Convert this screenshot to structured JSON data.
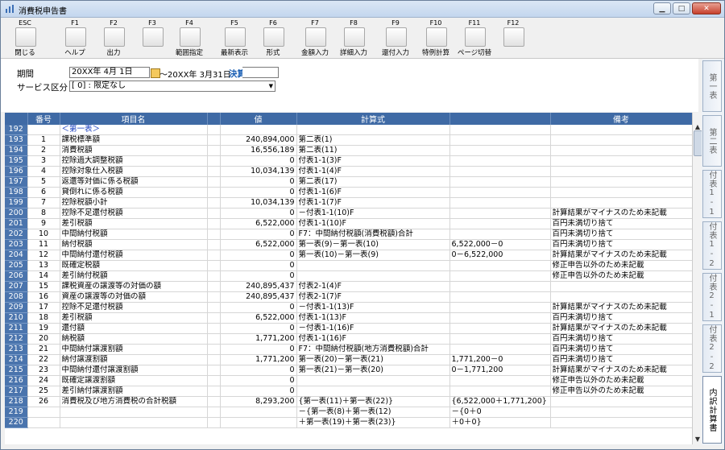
{
  "window": {
    "title": "消費税申告書",
    "btn_min": "▁",
    "btn_max": "□",
    "btn_close": "✕"
  },
  "toolbar": [
    {
      "key": "ESC",
      "label": "閉じる",
      "icon": "close-doc-icon"
    },
    {
      "key": "F1",
      "label": "ヘルプ",
      "icon": "help-icon"
    },
    {
      "key": "F2",
      "label": "出力",
      "icon": "print-icon"
    },
    {
      "key": "F3",
      "label": "",
      "icon": "disabled-icon"
    },
    {
      "key": "F4",
      "label": "範囲指定",
      "icon": "calendar-icon"
    },
    {
      "key": "F5",
      "label": "最新表示",
      "icon": "refresh-icon"
    },
    {
      "key": "F6",
      "label": "形式",
      "icon": "gear-icon"
    },
    {
      "key": "F7",
      "label": "金額入力",
      "icon": "coins-icon"
    },
    {
      "key": "F8",
      "label": "詳細入力",
      "icon": "book-icon"
    },
    {
      "key": "F9",
      "label": "還付入力",
      "icon": "book-blue-icon"
    },
    {
      "key": "F10",
      "label": "特例計算",
      "icon": "book-yellow-icon"
    },
    {
      "key": "F11",
      "label": "ページ切替",
      "icon": "page-switch-icon"
    },
    {
      "key": "F12",
      "label": "",
      "icon": "disabled-icon"
    }
  ],
  "form": {
    "period_label": "期間",
    "period_value": "20XX年  4月 1日",
    "period_end": "～20XX年  3月31日",
    "settlement": "決算",
    "service_label": "サービス区分",
    "service_value": "[      0] : 限定なし",
    "dropdown_arrow": "▼"
  },
  "table": {
    "headers": [
      "番号",
      "項目名",
      "",
      "値",
      "計算式",
      "",
      "備考"
    ],
    "rows": [
      {
        "id": "192",
        "no": "",
        "name": "＜第一表＞",
        "value": "",
        "formula": "",
        "calc": "",
        "note": "",
        "header": true
      },
      {
        "id": "193",
        "no": "1",
        "name": "課税標準額",
        "value": "240,894,000",
        "formula": "第二表(1)",
        "calc": "",
        "note": ""
      },
      {
        "id": "194",
        "no": "2",
        "name": "消費税額",
        "value": "16,556,189",
        "formula": "第二表(11)",
        "calc": "",
        "note": ""
      },
      {
        "id": "195",
        "no": "3",
        "name": "控除過大調整税額",
        "value": "0",
        "formula": "付表1-1(3)F",
        "calc": "",
        "note": ""
      },
      {
        "id": "196",
        "no": "4",
        "name": "控除対象仕入税額",
        "value": "10,034,139",
        "formula": "付表1-1(4)F",
        "calc": "",
        "note": ""
      },
      {
        "id": "197",
        "no": "5",
        "name": "返還等対価に係る税額",
        "value": "0",
        "formula": "第二表(17)",
        "calc": "",
        "note": ""
      },
      {
        "id": "198",
        "no": "6",
        "name": "貸倒れに係る税額",
        "value": "0",
        "formula": "付表1-1(6)F",
        "calc": "",
        "note": ""
      },
      {
        "id": "199",
        "no": "7",
        "name": "控除税額小計",
        "value": "10,034,139",
        "formula": "付表1-1(7)F",
        "calc": "",
        "note": ""
      },
      {
        "id": "200",
        "no": "8",
        "name": "控除不足還付税額",
        "value": "0",
        "formula": "－付表1-1(10)F",
        "calc": "",
        "note": "計算結果がマイナスのため未記載"
      },
      {
        "id": "201",
        "no": "9",
        "name": "差引税額",
        "value": "6,522,000",
        "formula": "付表1-1(10)F",
        "calc": "",
        "note": "百円未満切り捨て"
      },
      {
        "id": "202",
        "no": "10",
        "name": "中間納付税額",
        "value": "0",
        "formula": "F7：中間納付税額(消費税額)合計",
        "calc": "",
        "note": "百円未満切り捨て"
      },
      {
        "id": "203",
        "no": "11",
        "name": "納付税額",
        "value": "6,522,000",
        "formula": "第一表(9)－第一表(10)",
        "calc": "6,522,000－0",
        "note": "百円未満切り捨て"
      },
      {
        "id": "204",
        "no": "12",
        "name": "中間納付還付税額",
        "value": "0",
        "formula": "第一表(10)－第一表(9)",
        "calc": "0－6,522,000",
        "note": "計算結果がマイナスのため未記載"
      },
      {
        "id": "205",
        "no": "13",
        "name": "既確定税額",
        "value": "0",
        "formula": "",
        "calc": "",
        "note": "修正申告以外のため未記載"
      },
      {
        "id": "206",
        "no": "14",
        "name": "差引納付税額",
        "value": "0",
        "formula": "",
        "calc": "",
        "note": "修正申告以外のため未記載"
      },
      {
        "id": "207",
        "no": "15",
        "name": "課税資産の譲渡等の対価の額",
        "value": "240,895,437",
        "formula": "付表2-1(4)F",
        "calc": "",
        "note": ""
      },
      {
        "id": "208",
        "no": "16",
        "name": "資産の譲渡等の対価の額",
        "value": "240,895,437",
        "formula": "付表2-1(7)F",
        "calc": "",
        "note": ""
      },
      {
        "id": "209",
        "no": "17",
        "name": "控除不足還付税額",
        "value": "0",
        "formula": "－付表1-1(13)F",
        "calc": "",
        "note": "計算結果がマイナスのため未記載"
      },
      {
        "id": "210",
        "no": "18",
        "name": "差引税額",
        "value": "6,522,000",
        "formula": "付表1-1(13)F",
        "calc": "",
        "note": "百円未満切り捨て"
      },
      {
        "id": "211",
        "no": "19",
        "name": "還付額",
        "value": "0",
        "formula": "－付表1-1(16)F",
        "calc": "",
        "note": "計算結果がマイナスのため未記載"
      },
      {
        "id": "212",
        "no": "20",
        "name": "納税額",
        "value": "1,771,200",
        "formula": "付表1-1(16)F",
        "calc": "",
        "note": "百円未満切り捨て"
      },
      {
        "id": "213",
        "no": "21",
        "name": "中間納付譲渡割額",
        "value": "0",
        "formula": "F7：中間納付税額(地方消費税額)合計",
        "calc": "",
        "note": "百円未満切り捨て"
      },
      {
        "id": "214",
        "no": "22",
        "name": "納付譲渡割額",
        "value": "1,771,200",
        "formula": "第一表(20)－第一表(21)",
        "calc": "1,771,200－0",
        "note": "百円未満切り捨て"
      },
      {
        "id": "215",
        "no": "23",
        "name": "中間納付還付譲渡割額",
        "value": "0",
        "formula": "第一表(21)－第一表(20)",
        "calc": "0－1,771,200",
        "note": "計算結果がマイナスのため未記載"
      },
      {
        "id": "216",
        "no": "24",
        "name": "既確定譲渡割額",
        "value": "0",
        "formula": "",
        "calc": "",
        "note": "修正申告以外のため未記載"
      },
      {
        "id": "217",
        "no": "25",
        "name": "差引納付譲渡割額",
        "value": "0",
        "formula": "",
        "calc": "",
        "note": "修正申告以外のため未記載"
      },
      {
        "id": "218",
        "no": "26",
        "name": "消費税及び地方消費税の合計税額",
        "value": "8,293,200",
        "formula": "{第一表(11)＋第一表(22)}",
        "calc": "{6,522,000＋1,771,200}",
        "note": ""
      },
      {
        "id": "219",
        "no": "",
        "name": "",
        "value": "",
        "formula": "－{第一表(8)＋第一表(12)",
        "calc": "－{0＋0",
        "note": ""
      },
      {
        "id": "220",
        "no": "",
        "name": "",
        "value": "",
        "formula": "＋第一表(19)＋第一表(23)}",
        "calc": "＋0＋0}",
        "note": ""
      }
    ]
  },
  "sidetabs": [
    "第一表",
    "第二表",
    "付表1-1",
    "付表1-2",
    "付表2-1",
    "付表2-2",
    "内訳計算書"
  ],
  "colors": {
    "header_blue": "#3f6aa5",
    "row_number_blue": "#4a74ad",
    "link_blue": "#1a3fbf"
  }
}
